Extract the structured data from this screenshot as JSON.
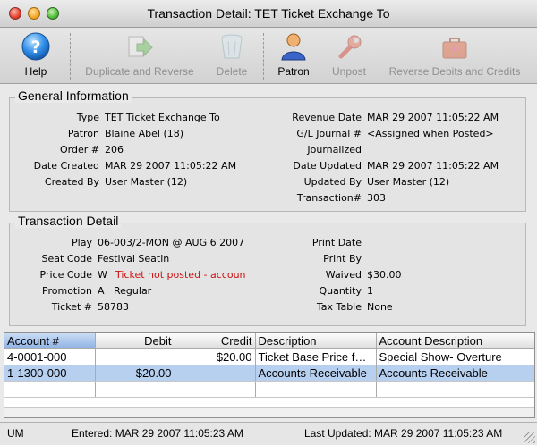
{
  "window": {
    "title": "Transaction Detail: TET Ticket Exchange To"
  },
  "toolbar": {
    "help": "Help",
    "duplicate_reverse": "Duplicate and Reverse",
    "delete": "Delete",
    "patron": "Patron",
    "unpost": "Unpost",
    "reverse_debits_credits": "Reverse Debits and Credits"
  },
  "general": {
    "title": "General Information",
    "left": [
      {
        "label": "Type",
        "value": "TET Ticket Exchange To"
      },
      {
        "label": "Patron",
        "value": "Blaine Abel (18)"
      },
      {
        "label": "Order #",
        "value": "206"
      },
      {
        "label": "Date Created",
        "value": "MAR 29 2007 11:05:22 AM"
      },
      {
        "label": "Created By",
        "value": "User Master (12)"
      }
    ],
    "right": [
      {
        "label": "Revenue Date",
        "value": "MAR 29 2007 11:05:22 AM"
      },
      {
        "label": "G/L Journal #",
        "value": "<Assigned when Posted>"
      },
      {
        "label": "Journalized",
        "value": ""
      },
      {
        "label": "Date Updated",
        "value": "MAR 29 2007 11:05:22 AM"
      },
      {
        "label": "Updated By",
        "value": "User Master (12)"
      },
      {
        "label": "Transaction#",
        "value": "303"
      }
    ]
  },
  "detail": {
    "title": "Transaction Detail",
    "left": [
      {
        "label": "Play",
        "value": "06-003/2-MON @ AUG 6 2007"
      },
      {
        "label": "Seat Code",
        "value": "Festival Seatin"
      },
      {
        "label": "Price Code",
        "value": "W",
        "note": "Ticket not posted - accoun"
      },
      {
        "label": "Promotion",
        "value": "A   Regular"
      },
      {
        "label": "Ticket #",
        "value": "58783"
      }
    ],
    "right": [
      {
        "label": "Print Date",
        "value": ""
      },
      {
        "label": "Print By",
        "value": ""
      },
      {
        "label": "Waived",
        "value": "$30.00"
      },
      {
        "label": "Quantity",
        "value": "1"
      },
      {
        "label": "Tax Table",
        "value": "None"
      }
    ]
  },
  "table": {
    "columns": [
      "Account #",
      "Debit",
      "Credit",
      "Description",
      "Account Description"
    ],
    "rows": [
      [
        "4-0001-000",
        "",
        "$20.00",
        "Ticket Base Price for Festival Seatin",
        "Special Show- Overture"
      ],
      [
        "1-1300-000",
        "$20.00",
        "",
        "Accounts Receivable",
        "Accounts Receivable"
      ]
    ]
  },
  "status": {
    "user": "UM",
    "entered": "Entered: MAR 29 2007 11:05:23 AM",
    "updated": "Last Updated: MAR 29 2007 11:05:23 AM"
  }
}
